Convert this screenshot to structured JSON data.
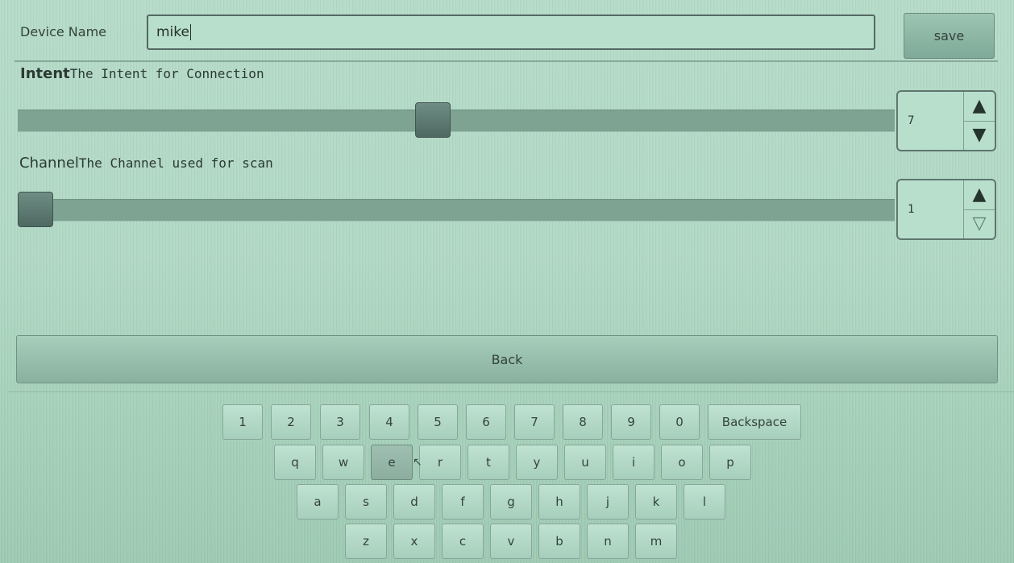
{
  "device": {
    "label": "Device Name",
    "value": "mike",
    "save_label": "save"
  },
  "intent": {
    "title": "Intent",
    "description": "The Intent for Connection",
    "value": "7",
    "level_fraction": 0.48
  },
  "channel": {
    "title": "Channel",
    "description": "The Channel used for scan",
    "value": "1",
    "level_fraction": 0.0
  },
  "back_label": "Back",
  "keyboard": {
    "row1": [
      "1",
      "2",
      "3",
      "4",
      "5",
      "6",
      "7",
      "8",
      "9",
      "0"
    ],
    "backspace": "Backspace",
    "row2": [
      "q",
      "w",
      "e",
      "r",
      "t",
      "y",
      "u",
      "i",
      "o",
      "p"
    ],
    "row3": [
      "a",
      "s",
      "d",
      "f",
      "g",
      "h",
      "j",
      "k",
      "l"
    ],
    "row4": [
      "z",
      "x",
      "c",
      "v",
      "b",
      "n",
      "m"
    ]
  },
  "icons": {
    "up": "triangle-up-icon",
    "down": "triangle-down-icon"
  }
}
